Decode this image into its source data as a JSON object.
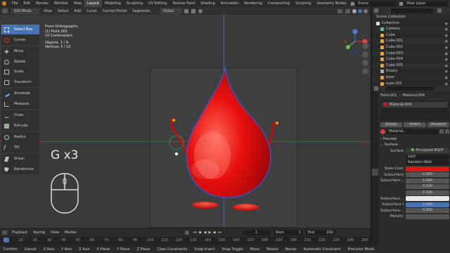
{
  "menu": {
    "items": [
      "File",
      "Edit",
      "Render",
      "Window",
      "Help"
    ],
    "workspaces": [
      "Layout",
      "Modeling",
      "Sculpting",
      "UV Editing",
      "Texture Paint",
      "Shading",
      "Animation",
      "Rendering",
      "Compositing",
      "Scripting",
      "Geometry Nodes"
    ],
    "active_workspace": "Layout",
    "scene": "Scene",
    "view_layer": "View Layer"
  },
  "header": {
    "mode": "Edit Mode",
    "menus": [
      "View",
      "Select",
      "Add",
      "Curve",
      "Control Points",
      "Segments"
    ],
    "orientation": "Global"
  },
  "tools": [
    "Select Box",
    "Cursor",
    "Move",
    "Rotate",
    "Scale",
    "Transform",
    "Annotate",
    "Measure",
    "Draw",
    "Extrude",
    "Radius",
    "Tilt",
    "Shear",
    "Randomize"
  ],
  "active_tool": "Select Box",
  "info": {
    "view": "Front Orthographic",
    "object": "(1) Point.001",
    "scale": "10 Centimeters",
    "objects_label": "Objects",
    "objects_value": "1 / 9",
    "vertices_label": "Vertices",
    "vertices_value": "3 / 12"
  },
  "overlay_text": "G x3",
  "colors": {
    "accent": "#4772b3",
    "drop_red": "#e8100e",
    "base_color": "#e01616",
    "panel": "#2b2b2b",
    "viewport": "#3a3a3a"
  },
  "outliner": {
    "title": "Scene Collection",
    "rows": [
      {
        "name": "Collection",
        "icon": "collection-icon"
      },
      {
        "name": "Camera",
        "icon": "camera-icon"
      },
      {
        "name": "Cube",
        "icon": "mesh-icon"
      },
      {
        "name": "Cube.001",
        "icon": "mesh-icon"
      },
      {
        "name": "Cube.002",
        "icon": "mesh-icon"
      },
      {
        "name": "Cube.003",
        "icon": "mesh-icon"
      },
      {
        "name": "Cube.004",
        "icon": "mesh-icon"
      },
      {
        "name": "Cube.005",
        "icon": "mesh-icon"
      },
      {
        "name": "Empty",
        "icon": "empty-icon"
      },
      {
        "name": "eyes",
        "icon": "mesh-icon"
      },
      {
        "name": "eyes.001",
        "icon": "mesh-icon"
      }
    ]
  },
  "properties": {
    "breadcrumb_object": "Point.001",
    "breadcrumb_material": "Material.004",
    "slot": "Material.004",
    "assign": "Assign",
    "select": "Select",
    "deselect": "Deselect",
    "material_name": "Material...",
    "preview": "Preview",
    "surface_header": "Surface",
    "surface_label": "Surface",
    "surface_value": "Principled BSDF",
    "distribution": "GGX",
    "subsurface_method": "Random Walk",
    "base_color_label": "Base Color",
    "subsurface_label": "Subsurface",
    "subsurface_value": "0.000",
    "subsurface_radius_label": "Subsurface ...",
    "radius_values": [
      "1.000",
      "0.200",
      "0.100"
    ],
    "subsurface_color_label": "Subsurface ...",
    "subsurface_ior_label": "Subsurface I",
    "subsurface_ior_value": "1.400",
    "subsurface_aniso_label": "Subsurface ...",
    "subsurface_aniso_value": "0.000",
    "metallic_label": "Metallic"
  },
  "timeline": {
    "menus": [
      "Playback",
      "Keying",
      "View",
      "Marker"
    ],
    "current_frame": "1",
    "start_label": "Start",
    "start": "1",
    "end_label": "End",
    "end": "250",
    "ruler": [
      "0",
      "10",
      "20",
      "30",
      "40",
      "50",
      "60",
      "70",
      "80",
      "90",
      "100",
      "110",
      "120",
      "130",
      "140",
      "150",
      "160",
      "170",
      "180",
      "190",
      "200",
      "210",
      "220",
      "230",
      "240",
      "250"
    ]
  },
  "status": [
    "Confirm",
    "Cancel",
    "X Axis",
    "Y Axis",
    "Z Axis",
    "X Plane",
    "Y Plane",
    "Z Plane",
    "Clear Constraints",
    "Snap Invert",
    "Snap Toggle",
    "Move",
    "Rotate",
    "Resize",
    "Automatic Constraint",
    "Precision Mode"
  ]
}
